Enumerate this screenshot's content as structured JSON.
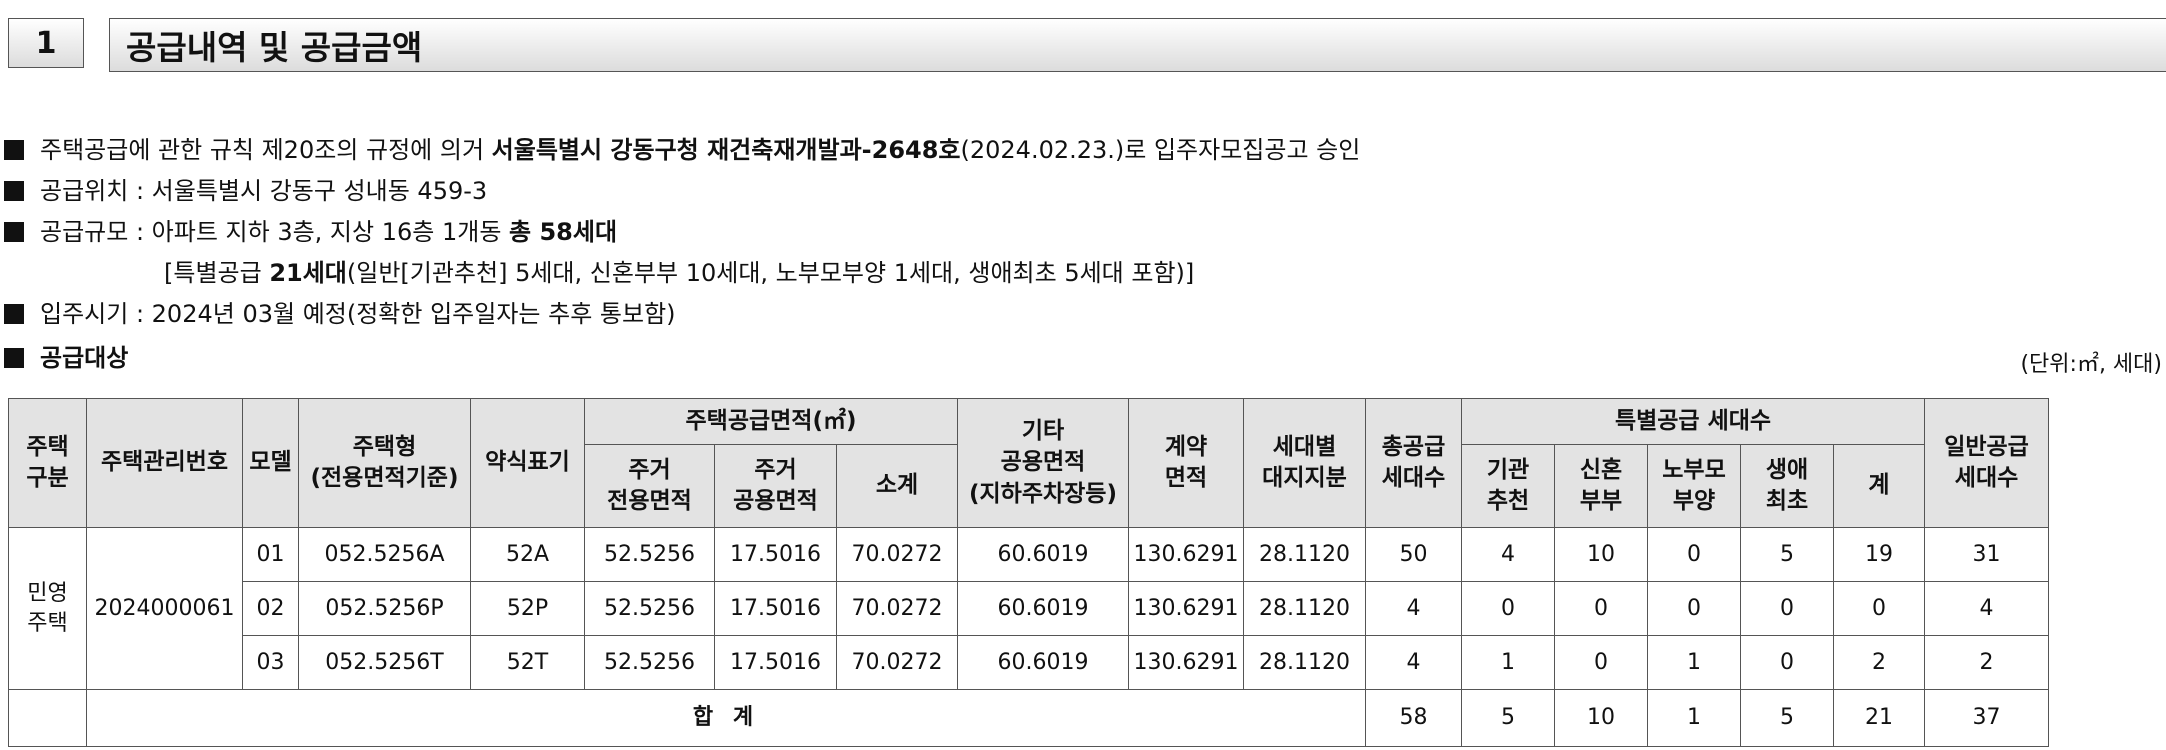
{
  "section": {
    "number": "1",
    "title": "공급내역 및 공급금액"
  },
  "info": {
    "line1": {
      "pre": "주택공급에 관한 규칙 제20조의 규정에 의거 ",
      "bold": "서울특별시 강동구청 재건축재개발과-2648호",
      "post": "(2024.02.23.)로 입주자모집공고 승인"
    },
    "line2": "공급위치 : 서울특별시 강동구 성내동 459-3",
    "line3": {
      "pre": "공급규모 : 아파트 지하 3층, 지상 16층 1개동 ",
      "bold": "총 58세대"
    },
    "line4": {
      "pre": "[특별공급 ",
      "bold": "21세대",
      "post": "(일반[기관추천] 5세대, 신혼부부 10세대, 노부모부양 1세대, 생애최초 5세대 포함)]"
    },
    "line5": "입주시기 : 2024년 03월 예정(정확한 입주일자는 추후 통보함)",
    "line6": "공급대상",
    "unit": "(단위:㎡, 세대)"
  },
  "table": {
    "headers": {
      "house_type": "주택\n구분",
      "mgmt_no": "주택관리번호",
      "model": "모델",
      "housing_type": "주택형\n(전용면적기준)",
      "abbr": "약식표기",
      "supply_area": "주택공급면적(㎡)",
      "excl_area": "주거\n전용면적",
      "common_area": "주거\n공용면적",
      "subtotal": "소계",
      "other_area": "기타\n공용면적\n(지하주차장등)",
      "contract_area": "계약\n면적",
      "land_share": "세대별\n대지지분",
      "total_units": "총공급\n세대수",
      "special": "특별공급 세대수",
      "inst": "기관\n추천",
      "newlywed": "신혼\n부부",
      "elderly": "노부모\n부양",
      "first": "생애\n최초",
      "sum": "계",
      "general": "일반공급\n세대수"
    },
    "house_type_value": "민영\n주택",
    "mgmt_no_value": "2024000061",
    "rows": [
      {
        "model": "01",
        "type": "052.5256A",
        "abbr": "52A",
        "excl": "52.5256",
        "common": "17.5016",
        "subtotal": "70.0272",
        "other": "60.6019",
        "contract": "130.6291",
        "land": "28.1120",
        "total": "50",
        "inst": "4",
        "newlywed": "10",
        "elderly": "0",
        "first": "5",
        "sum": "19",
        "general": "31"
      },
      {
        "model": "02",
        "type": "052.5256P",
        "abbr": "52P",
        "excl": "52.5256",
        "common": "17.5016",
        "subtotal": "70.0272",
        "other": "60.6019",
        "contract": "130.6291",
        "land": "28.1120",
        "total": "4",
        "inst": "0",
        "newlywed": "0",
        "elderly": "0",
        "first": "0",
        "sum": "0",
        "general": "4"
      },
      {
        "model": "03",
        "type": "052.5256T",
        "abbr": "52T",
        "excl": "52.5256",
        "common": "17.5016",
        "subtotal": "70.0272",
        "other": "60.6019",
        "contract": "130.6291",
        "land": "28.1120",
        "total": "4",
        "inst": "1",
        "newlywed": "0",
        "elderly": "1",
        "first": "0",
        "sum": "2",
        "general": "2"
      }
    ],
    "total": {
      "label": "합 계",
      "total": "58",
      "inst": "5",
      "newlywed": "10",
      "elderly": "1",
      "first": "5",
      "sum": "21",
      "general": "37"
    }
  }
}
